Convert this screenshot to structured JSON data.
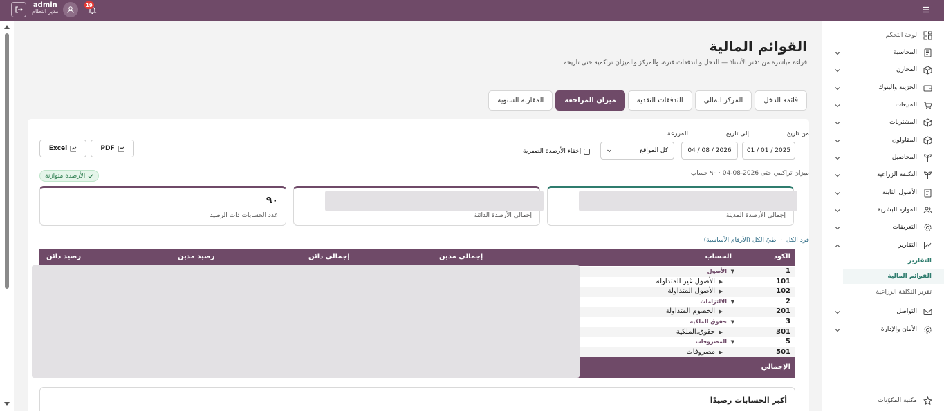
{
  "topbar": {
    "user_name": "admin",
    "user_role": "مدير النظام",
    "notification_count": "19"
  },
  "page": {
    "title": "القوائم المالية",
    "subtitle": "قراءة مباشرة من دفتر الأستاذ — الدخل والتدفقات فترة، والمركز والميزان تراكمية حتى تاريخه"
  },
  "tabs": [
    {
      "label": "قائمة الدخل",
      "active": false
    },
    {
      "label": "المركز المالي",
      "active": false
    },
    {
      "label": "التدفقات النقدية",
      "active": false
    },
    {
      "label": "ميزان المراجعة",
      "active": true
    },
    {
      "label": "المقارنة السنوية",
      "active": false
    }
  ],
  "filters": {
    "from_label": "من تاريخ",
    "from_value": "01 / 01 / 2025",
    "to_label": "إلى تاريخ",
    "to_value": "04 / 08 / 2026",
    "farm_label": "المزرعة",
    "farm_value": "كل المواقع",
    "hide_zero_label": "إخفاء الأرصدة الصفرية"
  },
  "export": {
    "pdf_label": "PDF",
    "excel_label": "Excel"
  },
  "summary": {
    "info": "ميزان تراكمي حتى 2026-08-04 · ٩٠ حساب",
    "balanced_label": "الأرصدة متوازنة",
    "total_debit_label": "إجمالي الأرصدة المدينة",
    "total_credit_label": "إجمالي الأرصدة الدائنة",
    "count_label": "عدد الحسابات ذات الرصيد",
    "count_value": "٩٠"
  },
  "table": {
    "expand_all": "فرد الكل",
    "separator": "·",
    "collapse_all": "طيّ الكل (الأرقام الأساسية)",
    "headers": {
      "code": "الكود",
      "account": "الحساب",
      "total_debit": "إجمالي مدين",
      "total_credit": "إجمالي دائن",
      "debit_balance": "رصيد مدين",
      "credit_balance": "رصيد دائن"
    },
    "rows": [
      {
        "code": "1",
        "name": "الأصول",
        "group": true
      },
      {
        "code": "101",
        "name": "الأصول غير المتداولة",
        "group": false
      },
      {
        "code": "102",
        "name": "الأصول المتداولة",
        "group": false
      },
      {
        "code": "2",
        "name": "الالتزامات",
        "group": true
      },
      {
        "code": "201",
        "name": "الخصوم المتداولة",
        "group": false
      },
      {
        "code": "3",
        "name": "حقوق الملكية",
        "group": true
      },
      {
        "code": "301",
        "name": "حقوق.الملكية",
        "group": false
      },
      {
        "code": "5",
        "name": "المصروفات",
        "group": true
      },
      {
        "code": "501",
        "name": "مصروفات",
        "group": false
      }
    ],
    "total_label": "الإجمالي"
  },
  "top_accounts_title": "أكبر الحسابات رصيدًا",
  "sidebar": {
    "items": [
      {
        "label": "لوحة التحكم",
        "icon": "dashboard-icon",
        "chevron": false
      },
      {
        "label": "المحاسبة",
        "icon": "ledger-icon",
        "chevron": true
      },
      {
        "label": "المخازن",
        "icon": "box-icon",
        "chevron": true
      },
      {
        "label": "الخزينة والبنوك",
        "icon": "wallet-icon",
        "chevron": true
      },
      {
        "label": "المبيعات",
        "icon": "cart-icon",
        "chevron": true
      },
      {
        "label": "المشتريات",
        "icon": "box-icon",
        "chevron": true
      },
      {
        "label": "المقاولون",
        "icon": "box-icon",
        "chevron": true
      },
      {
        "label": "المحاصيل",
        "icon": "sprout-icon",
        "chevron": true
      },
      {
        "label": "التكلفة الزراعية",
        "icon": "sprout-icon",
        "chevron": true
      },
      {
        "label": "الأصول الثابتة",
        "icon": "document-icon",
        "chevron": true
      },
      {
        "label": "الموارد البشرية",
        "icon": "users-icon",
        "chevron": true
      },
      {
        "label": "التعريفات",
        "icon": "gear-icon",
        "chevron": true
      },
      {
        "label": "التقارير",
        "icon": "chart-icon",
        "chevron": true,
        "expanded": true
      }
    ],
    "sub_items": [
      {
        "label": "التقارير",
        "state": "hl"
      },
      {
        "label": "القوائم المالية",
        "state": "active"
      },
      {
        "label": "تقرير التكلفة الزراعية",
        "state": "dim"
      }
    ],
    "bottom_items": [
      {
        "label": "التواصل",
        "icon": "mail-icon",
        "chevron": true
      },
      {
        "label": "الأمان والإدارة",
        "icon": "gear-icon",
        "chevron": true
      }
    ],
    "footer_label": "مكتبة المكوّنات"
  },
  "colors": {
    "brand": "#6f4a68",
    "accent_teal": "#2f7c6e",
    "balanced_green": "#2e7d4f",
    "badge_red": "#e53935"
  }
}
